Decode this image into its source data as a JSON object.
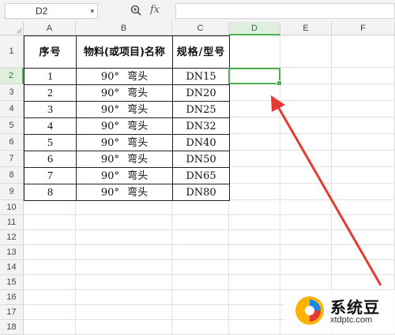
{
  "name_box": {
    "value": "D2"
  },
  "formula_bar": {
    "fx_label": "fx",
    "formula": ""
  },
  "columns": [
    "A",
    "B",
    "C",
    "D",
    "E",
    "F"
  ],
  "selected_column": "D",
  "rows": [
    "1",
    "2",
    "3",
    "4",
    "5",
    "6",
    "7",
    "8",
    "9",
    "10",
    "11",
    "12",
    "13",
    "14",
    "15",
    "16",
    "17",
    "18"
  ],
  "selected_row": "2",
  "table": {
    "headers": [
      "序号",
      "物料(或项目)名称",
      "规格/型号"
    ],
    "rows": [
      [
        "1",
        "90° 弯头",
        "DN15"
      ],
      [
        "2",
        "90° 弯头",
        "DN20"
      ],
      [
        "3",
        "90° 弯头",
        "DN25"
      ],
      [
        "4",
        "90° 弯头",
        "DN32"
      ],
      [
        "5",
        "90° 弯头",
        "DN40"
      ],
      [
        "6",
        "90° 弯头",
        "DN50"
      ],
      [
        "7",
        "90° 弯头",
        "DN65"
      ],
      [
        "8",
        "90° 弯头",
        "DN80"
      ]
    ]
  },
  "watermark": {
    "title": "系统豆",
    "url": "xtdptc.com"
  },
  "colors": {
    "accent": "#4caf50",
    "arrow": "#e53935",
    "header_bg": "#f3f3f3"
  }
}
